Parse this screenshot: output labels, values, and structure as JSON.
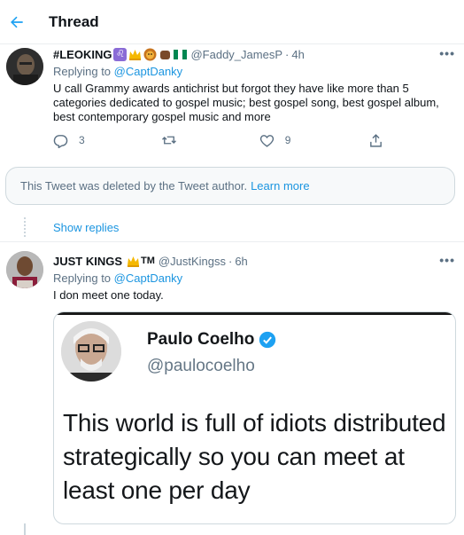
{
  "header": {
    "title": "Thread"
  },
  "tweet1": {
    "name": "#LEOKING",
    "handle": "@Faddy_JamesP",
    "time": "4h",
    "replying_prefix": "Replying to",
    "replying_to": "@CaptDanky",
    "text": "U call Grammy awards antichrist but forgot they have like more than 5 categories dedicated to gospel music; best gospel song, best gospel album, best contemporary gospel music and more",
    "reply_count": "3",
    "like_count": "9"
  },
  "deleted": {
    "text": "This Tweet was deleted by the Tweet author.",
    "link": "Learn more"
  },
  "show_replies": "Show replies",
  "tweet2": {
    "name": "JUST KINGS",
    "tm": "TM",
    "handle": "@JustKingss",
    "time": "6h",
    "replying_prefix": "Replying to",
    "replying_to": "@CaptDanky",
    "text": "I don meet one today.",
    "media": {
      "name": "Paulo Coelho",
      "handle": "@paulocoelho",
      "quote": "This world is full of idiots distributed strategically so you can meet at least one per day"
    }
  },
  "more_glyph": "•••",
  "dot": "·",
  "colors": {
    "accent": "#1da1f2",
    "link": "#1b95e0",
    "muted": "#5b7083"
  }
}
